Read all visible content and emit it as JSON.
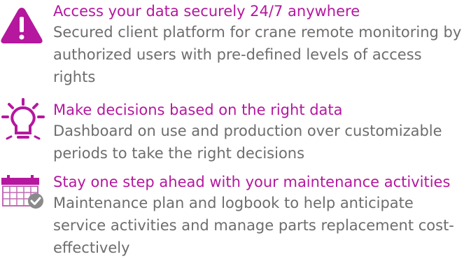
{
  "features": [
    {
      "icon": "warning-icon",
      "heading": "Access your data securely 24/7 anywhere",
      "description": "Secured client platform for crane remote monitoring by authorized users with pre-defined levels of access rights"
    },
    {
      "icon": "lightbulb-icon",
      "heading": "Make decisions based on the right data",
      "description": "Dashboard on use and production over customizable periods to take the right decisions"
    },
    {
      "icon": "calendar-check-icon",
      "heading": "Stay one step ahead with your maintenance activities",
      "description": "Maintenance plan and logbook to help anticipate service activities and manage parts replacement cost-effectively"
    }
  ],
  "colors": {
    "accent": "#b5179e",
    "text": "#6d6d6d",
    "calendar_header": "#b5179e",
    "calendar_grid": "#c06bb4",
    "check_badge": "#8a8a8a"
  }
}
